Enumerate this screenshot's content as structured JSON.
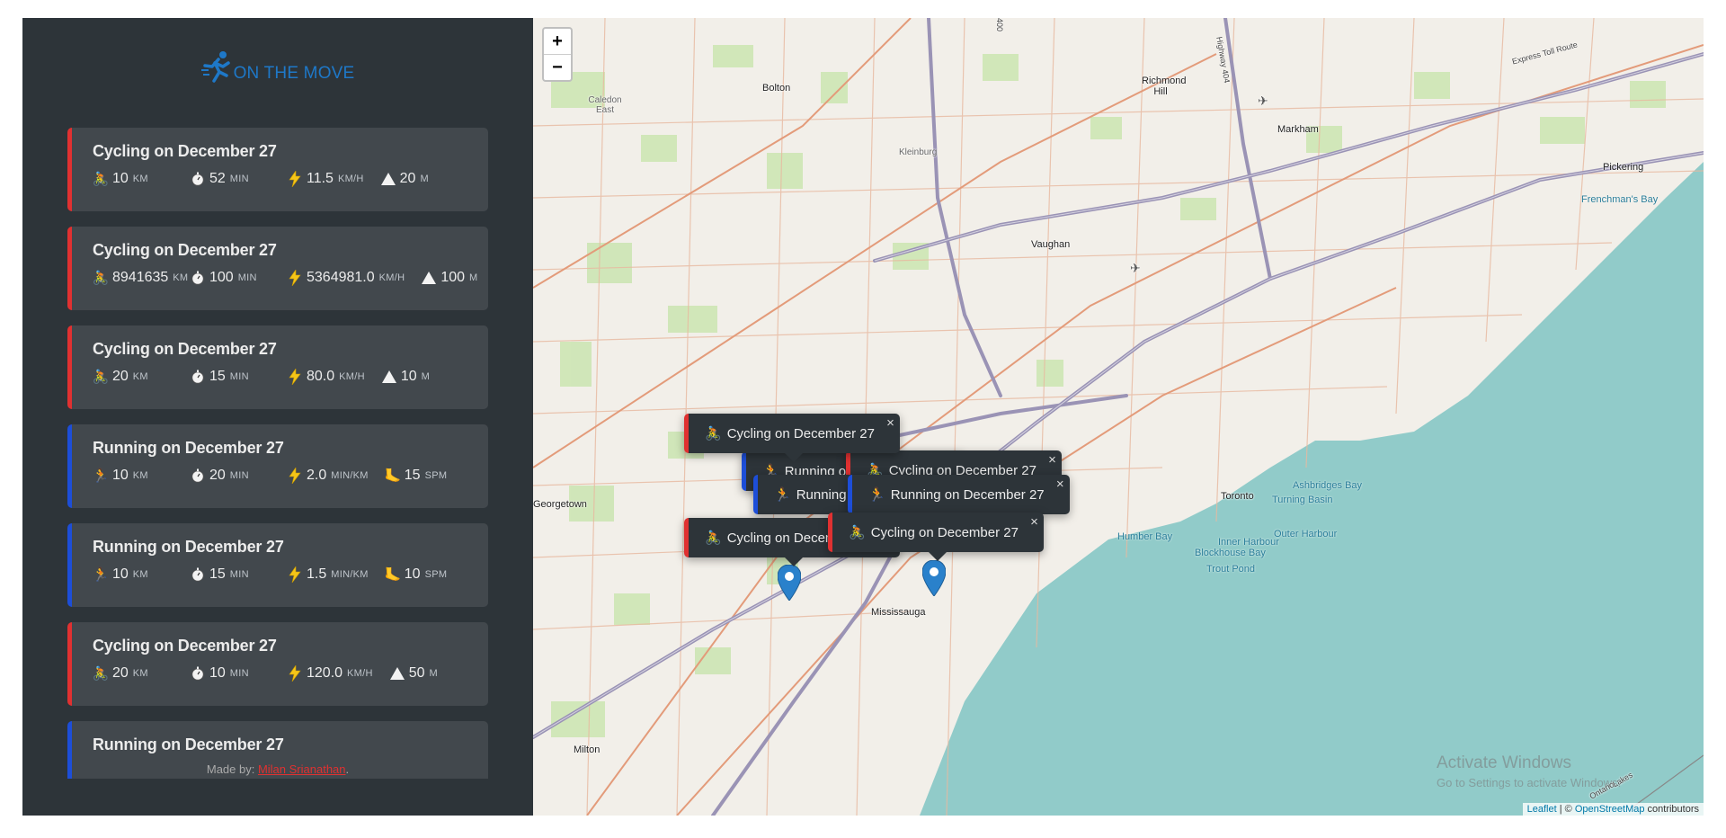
{
  "brand": {
    "title": "ON THE MOVE"
  },
  "workouts": [
    {
      "type": "cycling",
      "title": "Cycling on December 27",
      "distance": "10",
      "duration": "52",
      "speed": "11.5",
      "elev": "20",
      "emoji": "🚴",
      "speed_unit": "km/h",
      "last_unit": "m"
    },
    {
      "type": "cycling",
      "title": "Cycling on December 27",
      "distance": "8941635",
      "duration": "100",
      "speed": "5364981.0",
      "elev": "100",
      "emoji": "🚴",
      "speed_unit": "km/h",
      "last_unit": "m"
    },
    {
      "type": "cycling",
      "title": "Cycling on December 27",
      "distance": "20",
      "duration": "15",
      "speed": "80.0",
      "elev": "10",
      "emoji": "🚴",
      "speed_unit": "km/h",
      "last_unit": "m"
    },
    {
      "type": "running",
      "title": "Running on December 27",
      "distance": "10",
      "duration": "20",
      "speed": "2.0",
      "elev": "15",
      "emoji": "🏃",
      "speed_unit": "min/km",
      "last_unit": "spm"
    },
    {
      "type": "running",
      "title": "Running on December 27",
      "distance": "10",
      "duration": "15",
      "speed": "1.5",
      "elev": "10",
      "emoji": "🏃",
      "speed_unit": "min/km",
      "last_unit": "spm"
    },
    {
      "type": "cycling",
      "title": "Cycling on December 27",
      "distance": "20",
      "duration": "10",
      "speed": "120.0",
      "elev": "50",
      "emoji": "🚴",
      "speed_unit": "km/h",
      "last_unit": "m"
    },
    {
      "type": "running",
      "title": "Running on December 27",
      "distance": "",
      "duration": "",
      "speed": "",
      "elev": "",
      "emoji": "🏃",
      "speed_unit": "",
      "last_unit": ""
    }
  ],
  "units": {
    "distance": "km",
    "duration": "min"
  },
  "footer": {
    "prefix": "Made by: ",
    "author": "Milan Srianathan",
    "suffix": "."
  },
  "map": {
    "zoom_in": "+",
    "zoom_out": "−",
    "places": [
      "Bolton",
      "Caledon East",
      "Richmond Hill",
      "Markham",
      "Pickering",
      "Kleinburg",
      "Vaughan",
      "Georgetown",
      "Toronto",
      "Mississauga",
      "Milton",
      "Humber Bay",
      "Inner Harbour",
      "Outer Harbour",
      "Blockhouse Bay",
      "Trout Pond"
    ],
    "water_names": [
      "Frenchman's Bay",
      "Ashbridges Bay",
      "Turning Basin"
    ],
    "road_labels": [
      "Highway 404",
      "Express Toll Route",
      "400",
      "Ontario",
      "Lakes"
    ],
    "popups": [
      {
        "type": "cycling",
        "label": "Cycling on December 27"
      },
      {
        "type": "running",
        "label": "Running on December 27"
      },
      {
        "type": "cycling",
        "label": "Cycling on December 27"
      },
      {
        "type": "running",
        "label": "Running on December 27"
      },
      {
        "type": "running",
        "label": "Running on December 27"
      },
      {
        "type": "cycling",
        "label": "Cycling on December 27"
      },
      {
        "type": "cycling",
        "label": "Cycling on December 27"
      }
    ],
    "close_glyph": "×",
    "attribution": {
      "leaflet": "Leaflet",
      "sep": " | © ",
      "osm": "OpenStreetMap",
      "contrib": " contributors"
    },
    "watermark": {
      "line1": "Activate Windows",
      "line2": "Go to Settings to activate Windows."
    },
    "colors": {
      "land": "#f2efe9",
      "water": "#aad3df",
      "park": "#cde6b4",
      "road": "#e8a88a",
      "highway": "#9a93b5"
    }
  }
}
